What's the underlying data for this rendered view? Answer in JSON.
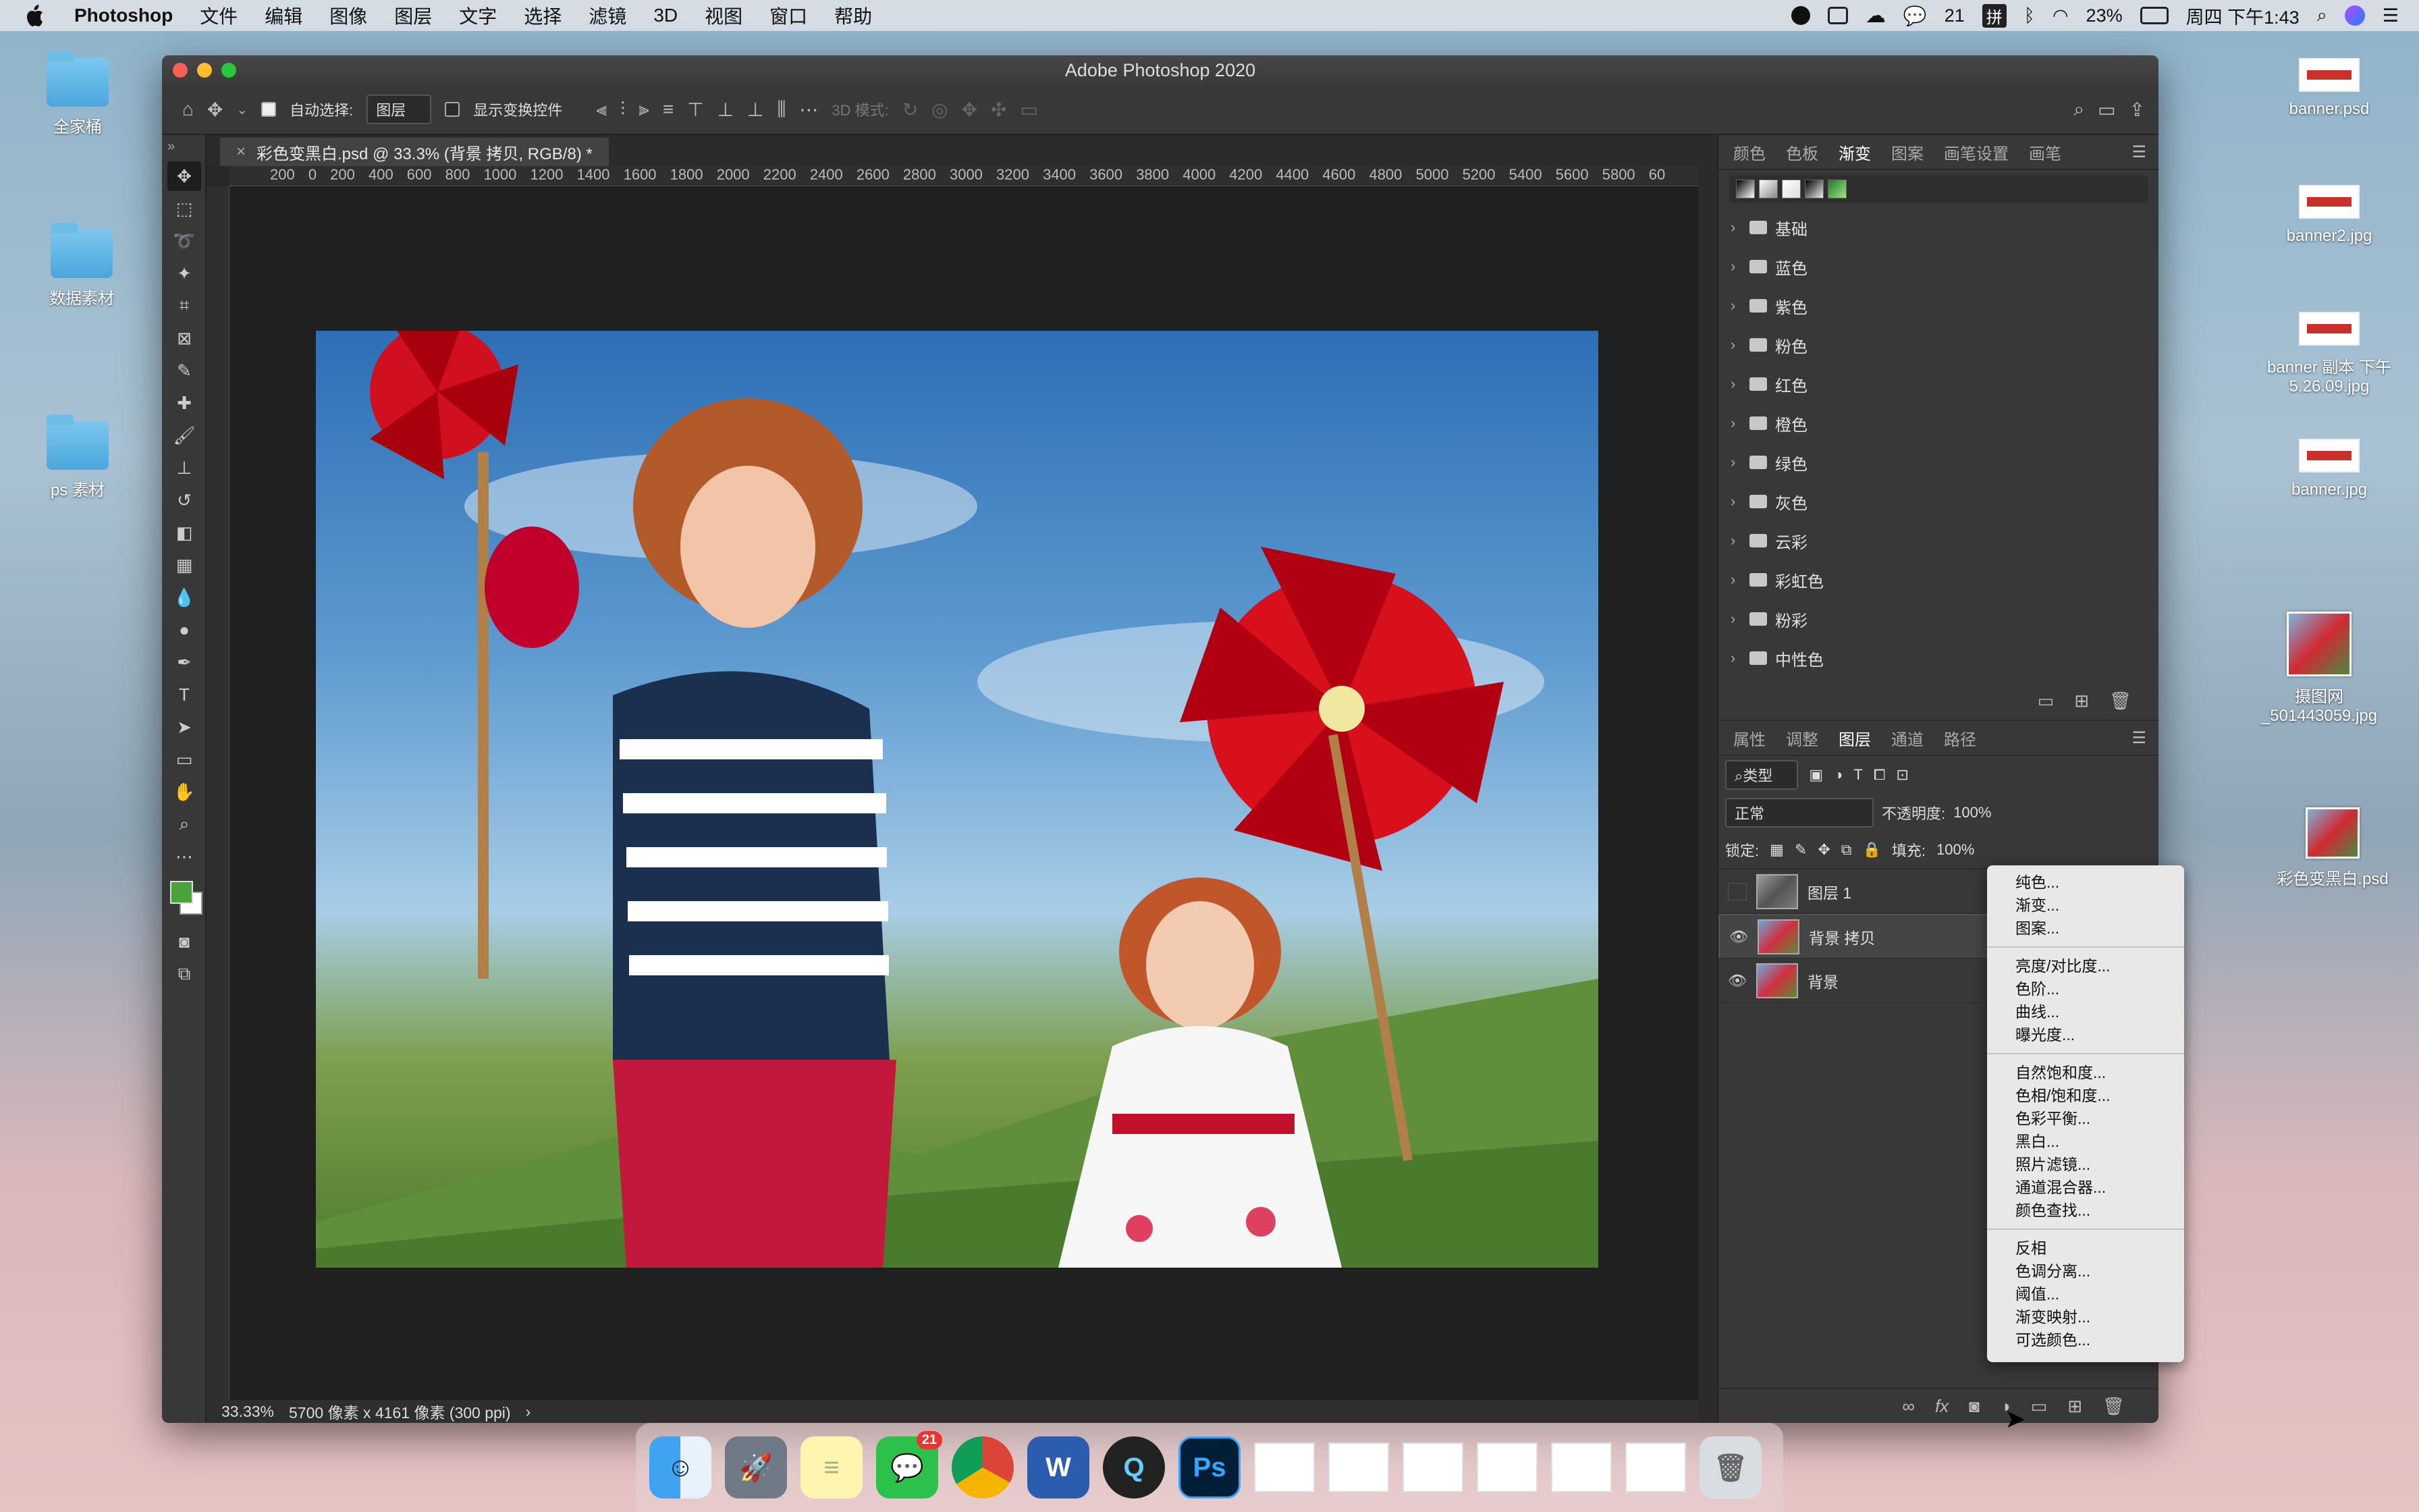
{
  "menubar": {
    "app": "Photoshop",
    "items": [
      "文件",
      "编辑",
      "图像",
      "图层",
      "文字",
      "选择",
      "滤镜",
      "3D",
      "视图",
      "窗口",
      "帮助"
    ],
    "wechat_count": "21",
    "battery": "23%",
    "clock": "周四 下午1:43"
  },
  "desktop": {
    "left": [
      {
        "label": "全家桶"
      },
      {
        "label": "数据素材"
      },
      {
        "label": "ps 素材"
      }
    ],
    "right": [
      {
        "label": "banner.psd"
      },
      {
        "label": "banner2.jpg"
      },
      {
        "label": "banner 副本 下午5.26.09.jpg"
      },
      {
        "label": "banner.jpg"
      },
      {
        "label": "摄图网_501443059.jpg"
      },
      {
        "label": "彩色变黑白.psd"
      }
    ]
  },
  "window": {
    "title": "Adobe Photoshop 2020"
  },
  "options": {
    "auto_select_label": "自动选择:",
    "auto_select_target": "图层",
    "show_transform_label": "显示变换控件",
    "mode_3d": "3D 模式:"
  },
  "document": {
    "tab": "彩色变黑白.psd @ 33.3% (背景 拷贝, RGB/8) *",
    "ruler_top": "200 0 200 400 600 800 1000 1200 1400 1600 1800 2000 2200 2400 2600 2800 3000 3200 3400 3600 3800 4000 4200 4400 4600 4800 5000 5200 5400 5600 5800 60"
  },
  "status": {
    "zoom": "33.33%",
    "info": "5700 像素 x 4161 像素 (300 ppi)"
  },
  "gradient_panel": {
    "tabs": [
      "颜色",
      "色板",
      "渐变",
      "图案",
      "画笔设置",
      "画笔"
    ],
    "active": "渐变",
    "folders": [
      "基础",
      "蓝色",
      "紫色",
      "粉色",
      "红色",
      "橙色",
      "绿色",
      "灰色",
      "云彩",
      "彩虹色",
      "粉彩",
      "中性色"
    ]
  },
  "layers_panel": {
    "tabs": [
      "属性",
      "调整",
      "图层",
      "通道",
      "路径"
    ],
    "active": "图层",
    "filter_label": "类型",
    "blend_mode": "正常",
    "opacity_label": "不透明度:",
    "opacity_value": "100%",
    "lock_label": "锁定:",
    "fill_label": "填充:",
    "fill_value": "100%",
    "layers": [
      {
        "name": "图层 1",
        "visible": false
      },
      {
        "name": "背景 拷贝",
        "visible": true
      },
      {
        "name": "背景",
        "visible": true
      }
    ]
  },
  "context_menu": {
    "groups": [
      [
        "纯色...",
        "渐变...",
        "图案..."
      ],
      [
        "亮度/对比度...",
        "色阶...",
        "曲线...",
        "曝光度..."
      ],
      [
        "自然饱和度...",
        "色相/饱和度...",
        "色彩平衡...",
        "黑白...",
        "照片滤镜...",
        "通道混合器...",
        "颜色查找..."
      ],
      [
        "反相",
        "色调分离...",
        "阈值...",
        "渐变映射...",
        "可选颜色..."
      ]
    ]
  },
  "dock": {
    "wechat_badge": "21"
  },
  "colors": {
    "foreground": "#4aa33a",
    "background": "#ffffff"
  }
}
